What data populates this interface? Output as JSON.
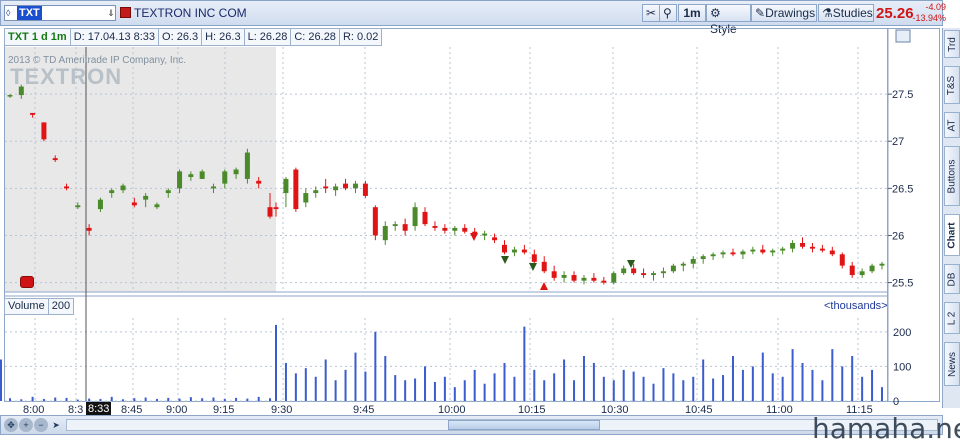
{
  "toolbar": {
    "symbol": "TXT",
    "company": "TEXTRON INC COM",
    "interval_btn": "1m",
    "style_btn": "Style",
    "drawings_btn": "Drawings",
    "studies_btn": "Studies",
    "last_price": "25.26",
    "change": "-4.09",
    "change_pct": "-13.94%"
  },
  "info": {
    "series": "TXT 1 d 1m",
    "date": "D: 17.04.13 8:33",
    "open": "O: 26.3",
    "high": "H: 26.3",
    "low": "L: 26.28",
    "close": "C: 26.28",
    "range": "R: 0.02"
  },
  "watermark": {
    "copyright": "2013 © TD Ameritrade IP Company, Inc.",
    "name": "TEXTRON"
  },
  "volume_panel": {
    "label": "Volume",
    "period": "200",
    "units": "<thousands>"
  },
  "cursor_time": "8:33",
  "side_tabs": [
    "Trd",
    "T&S",
    "AT",
    "Buttons",
    "Chart",
    "DB",
    "L 2",
    "News"
  ],
  "active_side_tab": "Chart",
  "site_mark": "hamaha.net",
  "colors": {
    "up": "#4a8a2a",
    "down": "#e01414",
    "volume": "#3a5ccf",
    "premarket": "#e8e8e8",
    "grid": "#b8c4d4"
  },
  "chart_data": {
    "type": "candlestick",
    "price_ticks": [
      25.5,
      26,
      26.5,
      27,
      27.5
    ],
    "price_range": [
      25.4,
      28.0
    ],
    "time_ticks": [
      "8:00",
      "8:30",
      "8:45",
      "9:00",
      "9:15",
      "9:30",
      "9:45",
      "10:00",
      "10:15",
      "10:30",
      "10:45",
      "11:00",
      "11:15"
    ],
    "volume_ticks": [
      0,
      100,
      200
    ],
    "volume_range": [
      0,
      240
    ],
    "candles": [
      [
        27.48,
        27.5,
        27.46,
        27.49
      ],
      [
        27.49,
        27.6,
        27.45,
        27.58
      ],
      [
        27.3,
        27.3,
        27.25,
        27.28
      ],
      [
        27.2,
        27.2,
        27.0,
        27.02
      ],
      [
        26.82,
        26.85,
        26.78,
        26.8
      ],
      [
        26.52,
        26.55,
        26.48,
        26.5
      ],
      [
        26.3,
        26.35,
        26.28,
        26.32
      ],
      [
        26.08,
        26.12,
        26.0,
        26.05
      ],
      [
        26.28,
        26.4,
        26.25,
        26.38
      ],
      [
        26.45,
        26.5,
        26.4,
        26.48
      ],
      [
        26.48,
        26.55,
        26.45,
        26.53
      ],
      [
        26.35,
        26.4,
        26.3,
        26.32
      ],
      [
        26.38,
        26.45,
        26.3,
        26.42
      ],
      [
        26.3,
        26.35,
        26.28,
        26.33
      ],
      [
        26.45,
        26.5,
        26.4,
        26.48
      ],
      [
        26.5,
        26.7,
        26.45,
        26.68
      ],
      [
        26.62,
        26.68,
        26.58,
        26.65
      ],
      [
        26.6,
        26.7,
        26.6,
        26.68
      ],
      [
        26.5,
        26.55,
        26.45,
        26.52
      ],
      [
        26.55,
        26.7,
        26.5,
        26.68
      ],
      [
        26.65,
        26.72,
        26.6,
        26.7
      ],
      [
        26.6,
        26.92,
        26.55,
        26.88
      ],
      [
        26.58,
        26.62,
        26.5,
        26.55
      ],
      [
        26.3,
        26.45,
        26.18,
        26.2
      ],
      [
        26.3,
        26.35,
        26.2,
        26.28
      ],
      [
        26.45,
        26.62,
        26.3,
        26.6
      ],
      [
        26.7,
        26.72,
        26.25,
        26.28
      ],
      [
        26.35,
        26.5,
        26.3,
        26.45
      ],
      [
        26.45,
        26.52,
        26.4,
        26.48
      ],
      [
        26.52,
        26.6,
        26.45,
        26.5
      ],
      [
        26.48,
        26.55,
        26.42,
        26.52
      ],
      [
        26.55,
        26.6,
        26.48,
        26.5
      ],
      [
        26.5,
        26.58,
        26.45,
        26.55
      ],
      [
        26.55,
        26.58,
        26.4,
        26.42
      ],
      [
        26.3,
        26.32,
        25.95,
        26.0
      ],
      [
        25.95,
        26.15,
        25.9,
        26.1
      ],
      [
        26.1,
        26.15,
        26.05,
        26.12
      ],
      [
        26.12,
        26.18,
        26.0,
        26.05
      ],
      [
        26.1,
        26.35,
        26.05,
        26.3
      ],
      [
        26.25,
        26.3,
        26.1,
        26.12
      ],
      [
        26.1,
        26.15,
        26.05,
        26.08
      ],
      [
        26.08,
        26.12,
        26.02,
        26.05
      ],
      [
        26.05,
        26.1,
        26.0,
        26.08
      ],
      [
        26.08,
        26.12,
        26.02,
        26.04
      ],
      [
        26.04,
        26.08,
        25.98,
        26.0
      ],
      [
        26.0,
        26.05,
        25.95,
        26.02
      ],
      [
        25.98,
        26.02,
        25.92,
        25.95
      ],
      [
        25.9,
        25.95,
        25.8,
        25.82
      ],
      [
        25.82,
        25.88,
        25.78,
        25.85
      ],
      [
        25.85,
        25.9,
        25.8,
        25.82
      ],
      [
        25.8,
        25.85,
        25.7,
        25.72
      ],
      [
        25.72,
        25.78,
        25.6,
        25.62
      ],
      [
        25.62,
        25.68,
        25.52,
        25.55
      ],
      [
        25.55,
        25.62,
        25.5,
        25.58
      ],
      [
        25.58,
        25.62,
        25.5,
        25.52
      ],
      [
        25.52,
        25.58,
        25.48,
        25.55
      ],
      [
        25.55,
        25.6,
        25.5,
        25.52
      ],
      [
        25.52,
        25.56,
        25.48,
        25.5
      ],
      [
        25.5,
        25.62,
        25.48,
        25.6
      ],
      [
        25.6,
        25.68,
        25.58,
        25.65
      ],
      [
        25.65,
        25.7,
        25.58,
        25.6
      ],
      [
        25.6,
        25.65,
        25.55,
        25.58
      ],
      [
        25.58,
        25.62,
        25.52,
        25.6
      ],
      [
        25.6,
        25.66,
        25.55,
        25.62
      ],
      [
        25.62,
        25.7,
        25.6,
        25.68
      ],
      [
        25.68,
        25.72,
        25.62,
        25.7
      ],
      [
        25.7,
        25.78,
        25.65,
        25.75
      ],
      [
        25.75,
        25.8,
        25.7,
        25.78
      ],
      [
        25.78,
        25.82,
        25.74,
        25.8
      ],
      [
        25.8,
        25.84,
        25.76,
        25.82
      ],
      [
        25.82,
        25.86,
        25.78,
        25.8
      ],
      [
        25.8,
        25.85,
        25.75,
        25.83
      ],
      [
        25.83,
        25.88,
        25.8,
        25.85
      ],
      [
        25.85,
        25.9,
        25.8,
        25.82
      ],
      [
        25.82,
        25.86,
        25.78,
        25.84
      ],
      [
        25.84,
        25.88,
        25.8,
        25.86
      ],
      [
        25.86,
        25.95,
        25.82,
        25.92
      ],
      [
        25.92,
        25.98,
        25.86,
        25.88
      ],
      [
        25.88,
        25.92,
        25.82,
        25.86
      ],
      [
        25.86,
        25.9,
        25.82,
        25.84
      ],
      [
        25.84,
        25.88,
        25.78,
        25.8
      ],
      [
        25.8,
        25.82,
        25.65,
        25.68
      ],
      [
        25.68,
        25.72,
        25.55,
        25.58
      ],
      [
        25.58,
        25.65,
        25.55,
        25.62
      ],
      [
        25.62,
        25.7,
        25.6,
        25.68
      ],
      [
        25.68,
        25.72,
        25.64,
        25.7
      ]
    ],
    "volumes": [
      8,
      5,
      12,
      6,
      10,
      9,
      4,
      7,
      6,
      12,
      5,
      8,
      10,
      6,
      9,
      7,
      11,
      8,
      10,
      6,
      9,
      7,
      12,
      8,
      220,
      110,
      80,
      95,
      70,
      120,
      60,
      90,
      140,
      85,
      200,
      130,
      75,
      60,
      65,
      100,
      55,
      70,
      40,
      60,
      90,
      50,
      80,
      110,
      70,
      215,
      90,
      60,
      80,
      120,
      60,
      130,
      110,
      70,
      60,
      90,
      85,
      70,
      50,
      95,
      80,
      60,
      70,
      120,
      65,
      75,
      130,
      90,
      100,
      140,
      80,
      70,
      150,
      110,
      90,
      60,
      150,
      100,
      130,
      70,
      90,
      40,
      120,
      60
    ]
  }
}
